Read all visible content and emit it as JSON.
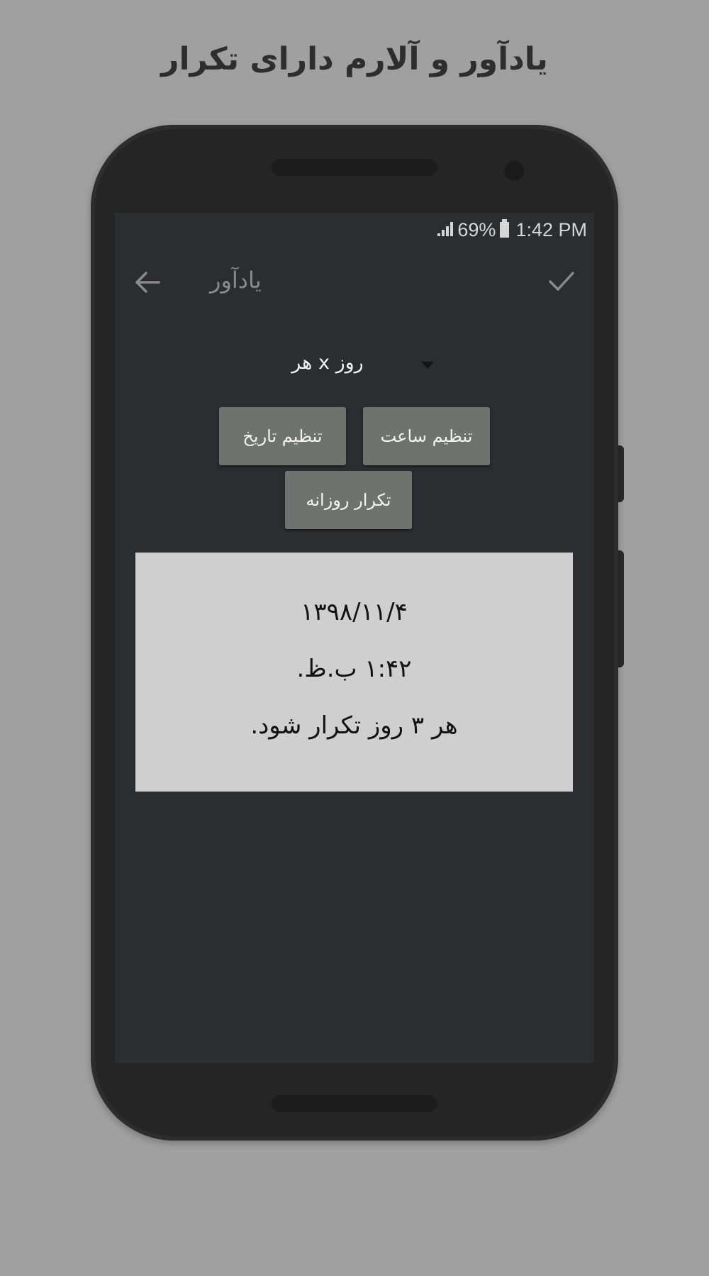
{
  "promo": {
    "headline": "یادآور و آلارم دارای تکرار"
  },
  "status_bar": {
    "battery_percent": "69%",
    "time": "1:42 PM",
    "icons": [
      "signal-icon",
      "battery-icon"
    ]
  },
  "toolbar": {
    "title": "یادآور",
    "back_icon": "arrow-left-icon",
    "confirm_icon": "check-icon"
  },
  "repeat_selector": {
    "selected": "هر x روز",
    "icon": "caret-down-icon"
  },
  "buttons": {
    "set_date": "تنظیم تاریخ",
    "set_time": "تنظیم ساعت",
    "daily_repeat": "تکرار روزانه"
  },
  "summary": {
    "date": "۱۳۹۸/۱۱/۴",
    "time": "۱:۴۲ ب.ظ.",
    "repeat": "هر ۳ روز تکرار شود."
  },
  "colors": {
    "background": "#a0a0a0",
    "screen": "#2c2d31",
    "button": "#6f736f",
    "card": "#cfcfcf"
  }
}
